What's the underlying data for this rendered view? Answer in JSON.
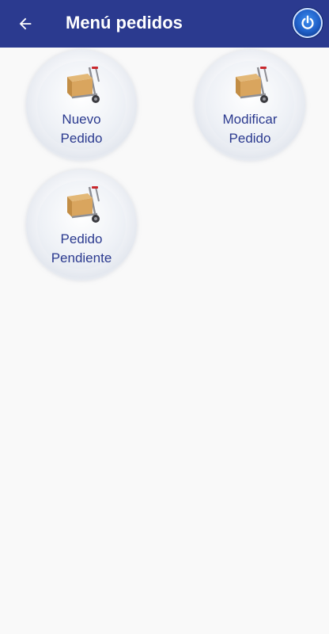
{
  "appbar": {
    "title": "Menú pedidos",
    "back_icon": "arrow-left-icon",
    "power_icon": "power-icon",
    "color": "#2b3a8f"
  },
  "menu": {
    "items": [
      {
        "line1": "Nuevo",
        "line2": "Pedido",
        "icon": "hand-truck-box-icon"
      },
      {
        "line1": "Modificar",
        "line2": "Pedido",
        "icon": "hand-truck-box-icon"
      },
      {
        "line1": "Pedido",
        "line2": "Pendiente",
        "icon": "hand-truck-box-icon"
      }
    ]
  }
}
